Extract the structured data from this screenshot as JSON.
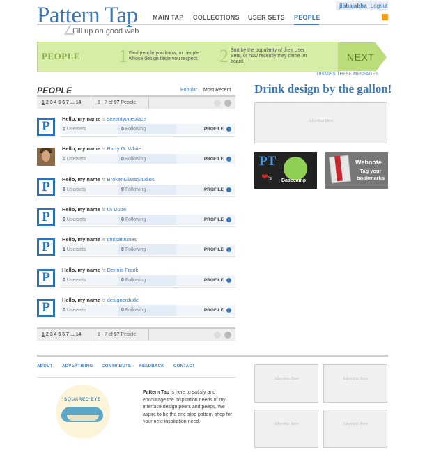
{
  "header": {
    "logo": "Pattern Tap",
    "tagline": "Fill up on good web",
    "nav": [
      "MAIN TAP",
      "COLLECTIONS",
      "USER SETS",
      "PEOPLE"
    ],
    "active_nav": "PEOPLE",
    "user": "jibbajabba",
    "logout": "Logout",
    "rss_icon": "rss-icon"
  },
  "banner": {
    "title": "PEOPLE",
    "step1_num": "1",
    "step1_text": "Find people you know, or people whose design taste you respect.",
    "step2_num": "2",
    "step2_text": "Sort by the popularity of their User Sets, or how recently they came on board.",
    "next": "NEXT",
    "dismiss": "DISMISS THESE MESSAGES"
  },
  "people": {
    "title": "PEOPLE",
    "sort_popular": "Popular",
    "sort_recent": "Most Recent",
    "pager": {
      "current": "1",
      "pages": "2 3 4 5 6 7 ... 14",
      "range": "1 - 7",
      "of": "of",
      "total": "97",
      "unit": "People"
    },
    "hello": "Hello, my name",
    "is": "is",
    "usersets_label": "Usersets",
    "following_label": "Following",
    "profile_label": "PROFILE",
    "list": [
      {
        "name": "seventyoneplace",
        "usersets": "0",
        "following": "0",
        "avatar": "default"
      },
      {
        "name": "Barry G. White",
        "usersets": "0",
        "following": "0",
        "avatar": "photo"
      },
      {
        "name": "BrokenGlassStudios",
        "usersets": "0",
        "following": "0",
        "avatar": "default"
      },
      {
        "name": "UI Dude",
        "usersets": "0",
        "following": "0",
        "avatar": "default"
      },
      {
        "name": "chrisantunes",
        "usersets": "1",
        "following": "0",
        "avatar": "default"
      },
      {
        "name": "Dennis Frank",
        "usersets": "0",
        "following": "0",
        "avatar": "default"
      },
      {
        "name": "designerdude",
        "usersets": "0",
        "following": "0",
        "avatar": "default"
      }
    ]
  },
  "sidebar": {
    "headline": "Drink design by the gallon!",
    "ad_text": "Advertise Here",
    "promo1": {
      "title": "PT",
      "connector": "'s",
      "brand": "Basecamp"
    },
    "promo2": {
      "brand": "Webnote",
      "tag": "Tag your bookmarks"
    }
  },
  "footer": {
    "links": [
      "ABOUT",
      "ADVERTISING",
      "CONTRIBUTE",
      "FEEDBACK",
      "CONTACT"
    ],
    "logo_text": "SQUARED EYE",
    "about_brand": "Pattern Tap",
    "about_text": " is here to satisfy and encourage the inspiration needs of my interface design peers and peeps. We aspire to be the one stop pattern shop for your next inspiration need.",
    "ad_text": "Advertise Here"
  }
}
